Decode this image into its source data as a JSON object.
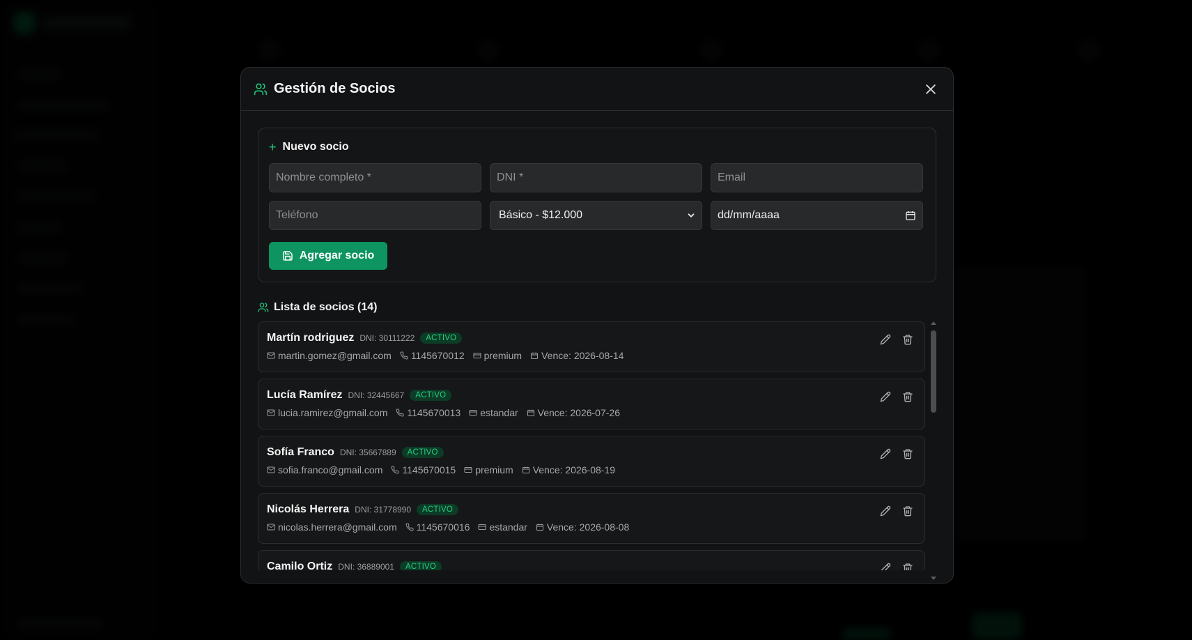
{
  "modal": {
    "title": "Gestión de Socios",
    "title_icon": "users-icon",
    "close_icon": "close-icon"
  },
  "form": {
    "title": "Nuevo socio",
    "name_placeholder": "Nombre completo *",
    "dni_placeholder": "DNI *",
    "email_placeholder": "Email",
    "phone_placeholder": "Teléfono",
    "plan_selected": "Básico - $12.000",
    "date_placeholder": "dd/mm/aaaa",
    "submit_label": "Agregar socio"
  },
  "list": {
    "title": "Lista de socios (14)",
    "members": [
      {
        "name": "Martín rodriguez",
        "dni": "DNI: 30111222",
        "status": "ACTIVO",
        "email": "martin.gomez@gmail.com",
        "phone": "1145670012",
        "plan": "premium",
        "expires": "Vence: 2026-08-14"
      },
      {
        "name": "Lucía Ramírez",
        "dni": "DNI: 32445667",
        "status": "ACTIVO",
        "email": "lucia.ramirez@gmail.com",
        "phone": "1145670013",
        "plan": "estandar",
        "expires": "Vence: 2026-07-26"
      },
      {
        "name": "Sofía Franco",
        "dni": "DNI: 35667889",
        "status": "ACTIVO",
        "email": "sofia.franco@gmail.com",
        "phone": "1145670015",
        "plan": "premium",
        "expires": "Vence: 2026-08-19"
      },
      {
        "name": "Nicolás Herrera",
        "dni": "DNI: 31778990",
        "status": "ACTIVO",
        "email": "nicolas.herrera@gmail.com",
        "phone": "1145670016",
        "plan": "estandar",
        "expires": "Vence: 2026-08-08"
      },
      {
        "name": "Camilo Ortiz",
        "dni": "DNI: 36889001",
        "status": "ACTIVO",
        "email": "",
        "phone": "",
        "plan": "",
        "expires": ""
      }
    ]
  },
  "colors": {
    "accent": "#0d9460",
    "badge_text": "#27cf83",
    "badge_bg": "#0c3b26",
    "modal_bg": "#121314"
  }
}
